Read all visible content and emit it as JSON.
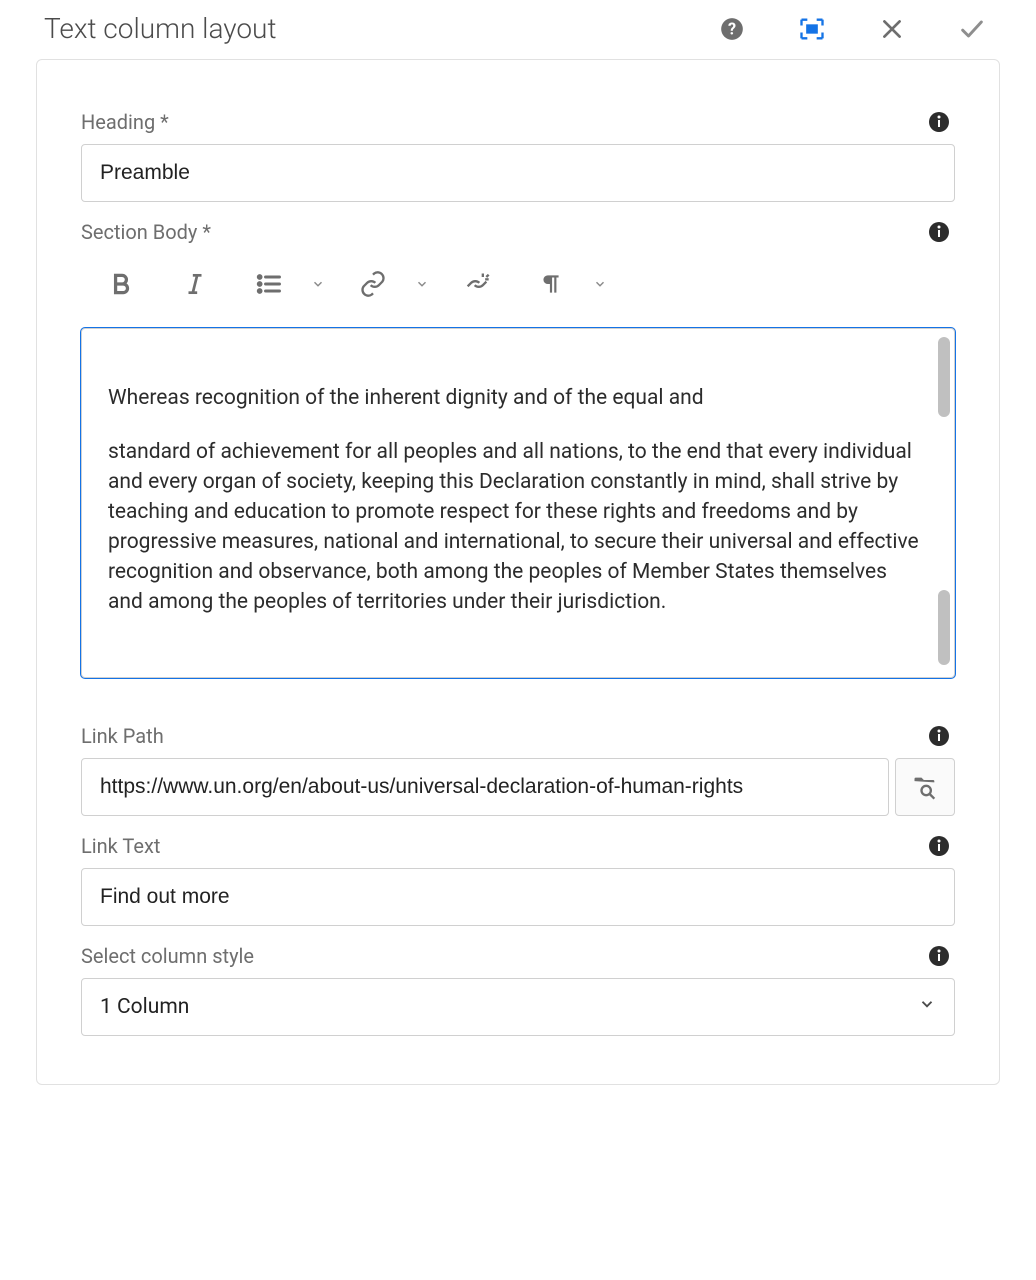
{
  "header": {
    "title": "Text column layout"
  },
  "fields": {
    "heading": {
      "label": "Heading *",
      "value": "Preamble"
    },
    "section_body": {
      "label": "Section Body *",
      "paragraphs": [
        "Whereas recognition of the inherent dignity and of the equal and",
        "standard of achievement for all peoples and all nations, to the end that every individual and every organ of society, keeping this Declaration constantly in mind, shall strive by teaching and education to promote respect for these rights and freedoms and by progressive measures, national and international, to secure their universal and effective recognition and observance, both among the peoples of Member States themselves and among the peoples of territories under their jurisdiction."
      ]
    },
    "link_path": {
      "label": "Link Path",
      "value": "https://www.un.org/en/about-us/universal-declaration-of-human-rights"
    },
    "link_text": {
      "label": "Link Text",
      "value": "Find out more"
    },
    "column_style": {
      "label": "Select column style",
      "value": "1 Column"
    }
  }
}
